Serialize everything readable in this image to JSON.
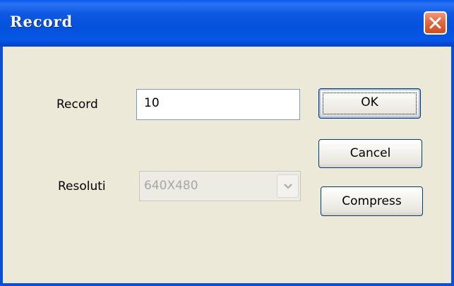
{
  "window": {
    "title": "Record",
    "colors": {
      "titlebar": "#0451dc",
      "border": "#0a4fd8",
      "face": "#ece9d8",
      "close": "#e06a43"
    }
  },
  "form": {
    "record_label": "Record",
    "record_value": "10",
    "resolution_label": "Resoluti",
    "resolution_value": "640X480"
  },
  "buttons": {
    "ok": "OK",
    "cancel": "Cancel",
    "compress": "Compress"
  },
  "icons": {
    "close": "close-icon",
    "dropdown": "chevron-down-icon"
  }
}
